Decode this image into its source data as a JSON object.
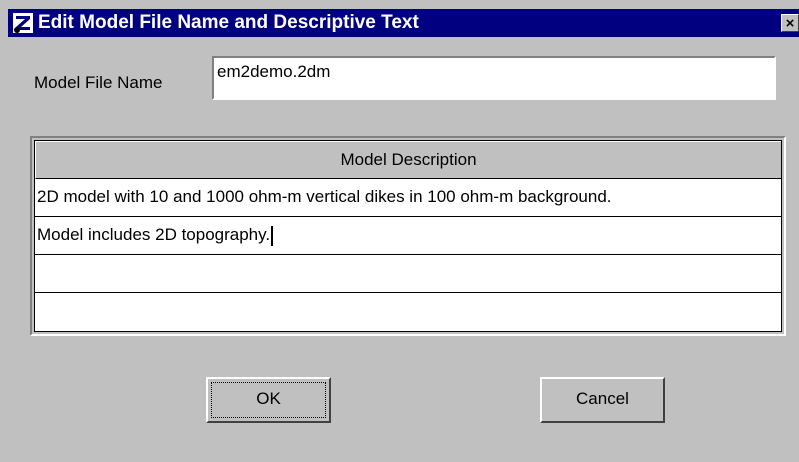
{
  "window": {
    "title": "Edit Model File Name and Descriptive Text",
    "close_label": "×",
    "app_icon": "z-app-icon"
  },
  "form": {
    "file_name_label": "Model File Name",
    "file_name_value": "em2demo.2dm"
  },
  "description_grid": {
    "header": "Model Description",
    "rows": [
      "2D model with 10 and 1000 ohm-m vertical dikes in 100 ohm-m background.",
      "Model includes 2D topography.",
      "",
      ""
    ]
  },
  "buttons": {
    "ok_label": "OK",
    "cancel_label": "Cancel"
  },
  "colors": {
    "titlebar": "#000080",
    "face": "#c0c0c0"
  }
}
